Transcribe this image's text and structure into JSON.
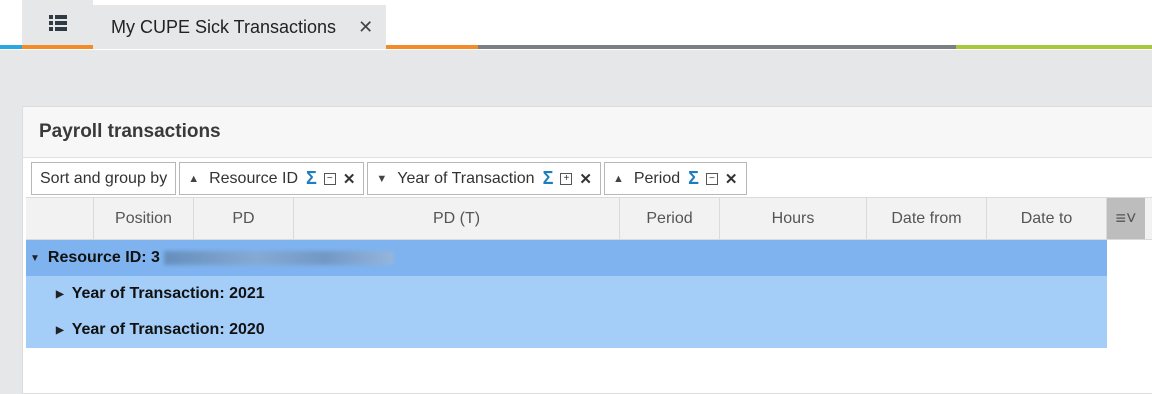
{
  "tabs": {
    "active_label": "My CUPE Sick Transactions",
    "close_glyph": "✕",
    "menu_icon": "list-icon"
  },
  "panel": {
    "title": "Payroll transactions"
  },
  "sort_group": {
    "button_label": "Sort and group by",
    "chips": [
      {
        "label": "Resource ID",
        "direction": "up",
        "sigma": "Σ",
        "toggle": "−"
      },
      {
        "label": "Year of Transaction",
        "direction": "down",
        "sigma": "Σ",
        "toggle": "+"
      },
      {
        "label": "Period",
        "direction": "up",
        "sigma": "Σ",
        "toggle": "−"
      }
    ]
  },
  "columns": [
    "Position",
    "PD",
    "PD (T)",
    "Period",
    "Hours",
    "Date from",
    "Date to"
  ],
  "groups": {
    "resource_label": "Resource ID: 3",
    "years": [
      "Year of Transaction: 2021",
      "Year of Transaction: 2020"
    ]
  },
  "colors": {
    "accent_blue": "#2aa9e0",
    "accent_orange": "#f28c28",
    "accent_gray": "#7b7f84",
    "accent_green": "#a6c83a",
    "group_level1": "#7eb3f0",
    "group_level2": "#a4cdf8",
    "sigma": "#1e7cc0"
  }
}
